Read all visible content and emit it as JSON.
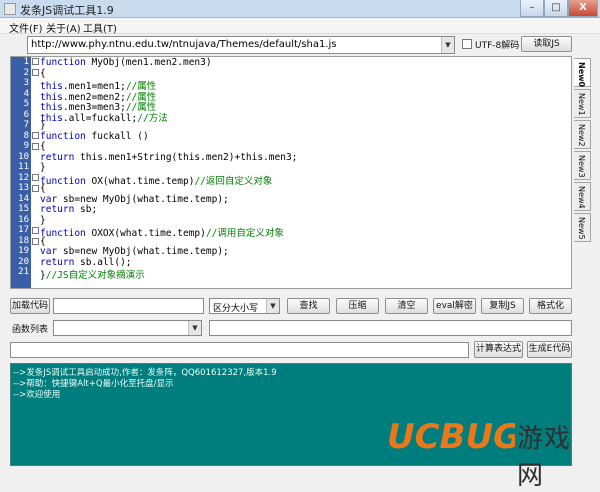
{
  "window": {
    "title": "发条JS调试工具1.9",
    "min_glyph": "–",
    "max_glyph": "□",
    "close_glyph": "X"
  },
  "menu": [
    "文件(F)",
    "关于(A)",
    "工具(T)"
  ],
  "url_bar": {
    "value": "http://www.phy.ntnu.edu.tw/ntnujava/Themes/default/sha1.js",
    "arrow": "▼"
  },
  "utf8_label": "UTF-8解码",
  "read_js_button": "读取JS",
  "editor": {
    "line_numbers": [
      "1",
      "2",
      "3",
      "4",
      "5",
      "6",
      "7",
      "8",
      "9",
      "10",
      "11",
      "12",
      "13",
      "14",
      "15",
      "16",
      "17",
      "18",
      "19",
      "20",
      "21"
    ],
    "lines": [
      {
        "pre": "",
        "kw": "function",
        "text": " MyObj(men1.men2.men3)",
        "comment": ""
      },
      {
        "pre": "",
        "kw": "",
        "text": "{",
        "comment": ""
      },
      {
        "pre": "",
        "kw": "this",
        "text": ".men1=men1;",
        "comment": "//属性"
      },
      {
        "pre": "",
        "kw": "this",
        "text": ".men2=men2;",
        "comment": "//属性"
      },
      {
        "pre": "",
        "kw": "this",
        "text": ".men3=men3;",
        "comment": "//属性"
      },
      {
        "pre": "",
        "kw": "this",
        "text": ".all=fuckall;",
        "comment": "//方法"
      },
      {
        "pre": "",
        "kw": "",
        "text": "}",
        "comment": ""
      },
      {
        "pre": "",
        "kw": "function",
        "text": " fuckall ()",
        "comment": ""
      },
      {
        "pre": "",
        "kw": "",
        "text": "{",
        "comment": ""
      },
      {
        "pre": "",
        "kw": "return",
        "text": " this.men1+String(this.men2)+this.men3;",
        "comment": ""
      },
      {
        "pre": "",
        "kw": "",
        "text": "}",
        "comment": ""
      },
      {
        "pre": "",
        "kw": "function",
        "text": " OX(what.time.temp)",
        "comment": "//返回自定义对象"
      },
      {
        "pre": "",
        "kw": "",
        "text": "{",
        "comment": ""
      },
      {
        "pre": "",
        "kw": "var",
        "text": " sb=new MyObj(what.time.temp);",
        "comment": ""
      },
      {
        "pre": "",
        "kw": "return",
        "text": " sb;",
        "comment": ""
      },
      {
        "pre": "",
        "kw": "",
        "text": "}",
        "comment": ""
      },
      {
        "pre": "",
        "kw": "function",
        "text": " OXOX(what.time.temp)",
        "comment": "//调用自定义对象"
      },
      {
        "pre": "",
        "kw": "",
        "text": "{",
        "comment": ""
      },
      {
        "pre": "",
        "kw": "var",
        "text": " sb=new MyObj(what.time.temp);",
        "comment": ""
      },
      {
        "pre": "",
        "kw": "return",
        "text": " sb.all();",
        "comment": ""
      },
      {
        "pre": "",
        "kw": "",
        "text": "}",
        "comment": "//JS自定义对象摘演示"
      }
    ]
  },
  "side_tabs": [
    "New0",
    "New1",
    "New2",
    "New3",
    "New4",
    "New5"
  ],
  "toolbar": {
    "load_code": "加载代码",
    "case_select": "区分大小写",
    "find": "查找",
    "compress": "压缩",
    "clear": "清空",
    "eval_decode": "eval解密",
    "copy_js": "复制JS",
    "format": "格式化"
  },
  "function_list_label": "函数列表",
  "calc_button": "计算表达式",
  "gen_e_button": "生成E代码",
  "log": [
    "-->发条JS调试工具启动成功,作者：发条阵，QQ601612327,版本1.9",
    "-->帮助：快捷键Alt+Q最小化至托盘/显示",
    "-->欢迎使用"
  ],
  "watermark": {
    "logo_text": "UCBUG",
    "cn_text": "游戏网"
  },
  "colors": {
    "gutter": "#3a5ea8",
    "keyword": "#0000c0",
    "comment": "#008000",
    "log_bg": "#007d7d"
  }
}
